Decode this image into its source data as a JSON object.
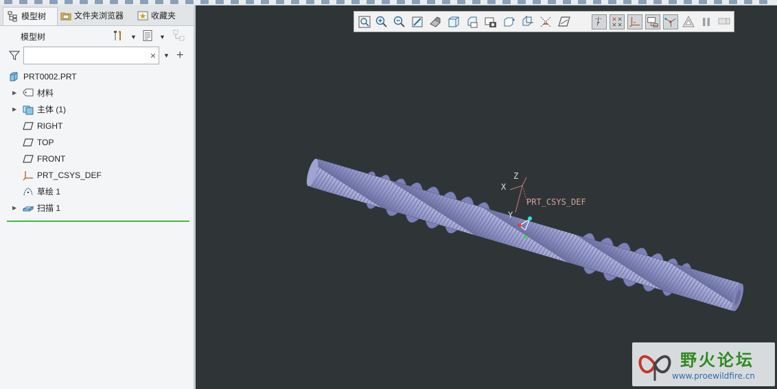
{
  "tabs": [
    {
      "label": "模型树",
      "icon": "model-tree-icon"
    },
    {
      "label": "文件夹浏览器",
      "icon": "folder-browser-icon"
    },
    {
      "label": "收藏夹",
      "icon": "favorites-icon"
    }
  ],
  "model_tree": {
    "title": "模型树",
    "search": {
      "value": "",
      "placeholder": ""
    },
    "items": [
      {
        "label": "PRT0002.PRT",
        "icon": "part-icon",
        "expandable": false
      },
      {
        "label": "材料",
        "icon": "material-icon",
        "expandable": true
      },
      {
        "label": "主体 (1)",
        "icon": "body-icon",
        "expandable": true
      },
      {
        "label": "RIGHT",
        "icon": "datum-plane-icon",
        "expandable": false
      },
      {
        "label": "TOP",
        "icon": "datum-plane-icon",
        "expandable": false
      },
      {
        "label": "FRONT",
        "icon": "datum-plane-icon",
        "expandable": false
      },
      {
        "label": "PRT_CSYS_DEF",
        "icon": "csys-icon",
        "expandable": false
      },
      {
        "label": "草绘 1",
        "icon": "sketch-icon",
        "expandable": false
      },
      {
        "label": "扫描 1",
        "icon": "sweep-icon",
        "expandable": true
      }
    ]
  },
  "graphics_toolbar": [
    "refit-icon",
    "zoom-in-icon",
    "zoom-out-icon",
    "repaint-icon",
    "display-style-icon",
    "saved-orientations-icon",
    "view-manager-icon",
    "perspective-icon",
    "spin-center-icon",
    "plane-display-icon",
    "axis-display-icon",
    "point-display-icon",
    "csys-display-icon",
    "annotation-display-icon",
    "datum-plane-tag-icon",
    "point-tag-icon",
    "csys-tag-icon",
    "spin-center-display-icon",
    "pause-icon",
    "appearance-icon"
  ],
  "viewport": {
    "csys_label": "PRT_CSYS_DEF",
    "axis_x": "X",
    "axis_y": "Y",
    "axis_z": "Z",
    "model_color": "#8e94c6",
    "background_color": "#2f3536"
  },
  "watermark": {
    "title": "野火论坛",
    "url": "www.proewildfire.cn"
  }
}
